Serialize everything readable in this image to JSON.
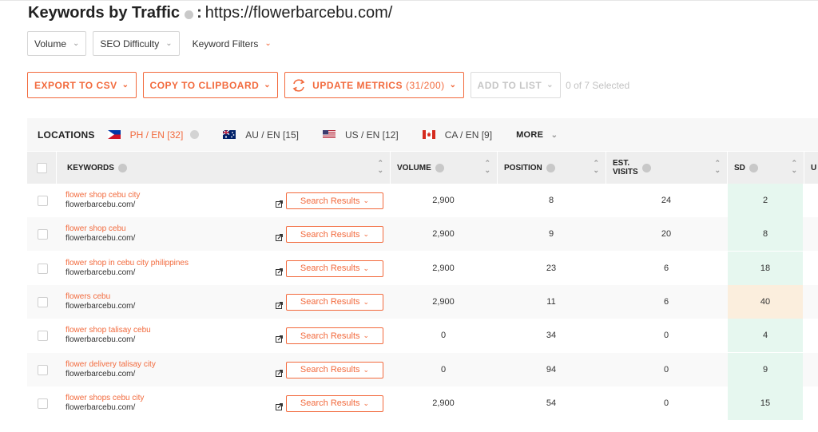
{
  "header": {
    "title": "Keywords by Traffic",
    "colon": ":",
    "url": "https://flowerbarcebu.com/"
  },
  "filters": [
    {
      "label": "Volume",
      "chevron": "⌄"
    },
    {
      "label": "SEO Difficulty",
      "chevron": "⌄"
    },
    {
      "label": "Keyword Filters",
      "chevron": "⌄"
    }
  ],
  "actions": {
    "export_label": "EXPORT TO CSV",
    "copy_label": "COPY TO CLIPBOARD",
    "update_label": "UPDATE METRICS",
    "update_count": "(31/200)",
    "add_label": "ADD TO LIST",
    "selected_text": "0 of 7 Selected"
  },
  "locations": {
    "label": "LOCATIONS",
    "items": [
      {
        "label": "PH / EN",
        "count": "[32]",
        "flag": "philippines-flag",
        "active": true
      },
      {
        "label": "AU / EN",
        "count": "[15]",
        "flag": "australia-flag",
        "active": false
      },
      {
        "label": "US / EN",
        "count": "[12]",
        "flag": "us-flag",
        "active": false
      },
      {
        "label": "CA / EN",
        "count": "[9]",
        "flag": "canada-flag",
        "active": false
      }
    ],
    "more_label": "MORE"
  },
  "table": {
    "columns": {
      "keywords": "KEYWORDS",
      "volume": "VOLUME",
      "position": "POSITION",
      "est_visits_1": "EST.",
      "est_visits_2": "VISITS",
      "sd": "SD",
      "next": "U"
    },
    "search_results_label": "Search Results",
    "rows": [
      {
        "keyword": "flower shop cebu city",
        "url": "flowerbarcebu.com/",
        "volume": "2,900",
        "position": "8",
        "visits": "24",
        "sd": "2",
        "sd_color": "#e6f7ef"
      },
      {
        "keyword": "flower shop cebu",
        "url": "flowerbarcebu.com/",
        "volume": "2,900",
        "position": "9",
        "visits": "20",
        "sd": "8",
        "sd_color": "#e6f7ef"
      },
      {
        "keyword": "flower shop in cebu city philippines",
        "url": "flowerbarcebu.com/",
        "volume": "2,900",
        "position": "23",
        "visits": "6",
        "sd": "18",
        "sd_color": "#e6f7ef"
      },
      {
        "keyword": "flowers cebu",
        "url": "flowerbarcebu.com/",
        "volume": "2,900",
        "position": "11",
        "visits": "6",
        "sd": "40",
        "sd_color": "#fbeedd"
      },
      {
        "keyword": "flower shop talisay cebu",
        "url": "flowerbarcebu.com/",
        "volume": "0",
        "position": "34",
        "visits": "0",
        "sd": "4",
        "sd_color": "#e6f7ef"
      },
      {
        "keyword": "flower delivery talisay city",
        "url": "flowerbarcebu.com/",
        "volume": "0",
        "position": "94",
        "visits": "0",
        "sd": "9",
        "sd_color": "#e6f7ef"
      },
      {
        "keyword": "flower shops cebu city",
        "url": "flowerbarcebu.com/",
        "volume": "2,900",
        "position": "54",
        "visits": "0",
        "sd": "15",
        "sd_color": "#e6f7ef"
      }
    ]
  },
  "colors": {
    "accent": "#f26a3d",
    "sd_easy": "#e6f7ef",
    "sd_medium": "#fbeedd"
  }
}
